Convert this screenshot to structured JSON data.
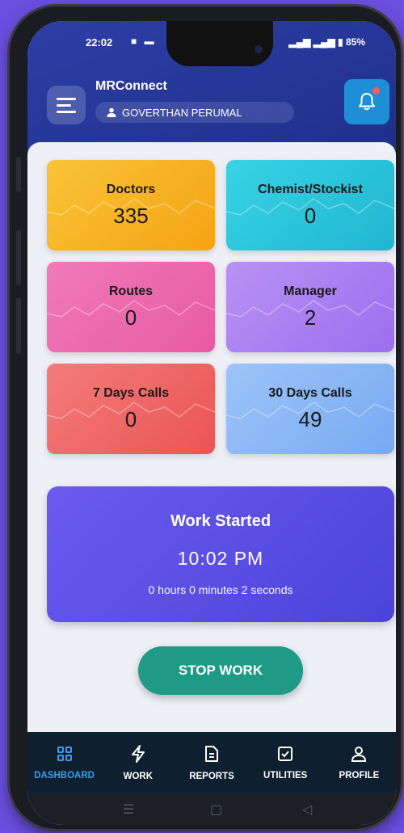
{
  "status_bar": {
    "time": "22:02",
    "left_icons": "■ ▬",
    "right_text": "85%"
  },
  "header": {
    "app_title": "MRConnect",
    "user_name": "GOVERTHAN PERUMAL"
  },
  "stats": [
    {
      "label": "Doctors",
      "value": "335",
      "color_from": "#f8c436",
      "color_to": "#f5a314"
    },
    {
      "label": "Chemist/Stockist",
      "value": "0",
      "color_from": "#38d3e4",
      "color_to": "#20b6d0"
    },
    {
      "label": "Routes",
      "value": "0",
      "color_from": "#f07ab9",
      "color_to": "#e85aa3"
    },
    {
      "label": "Manager",
      "value": "2",
      "color_from": "#b892f3",
      "color_to": "#9c6ef0"
    },
    {
      "label": "7 Days Calls",
      "value": "0",
      "color_from": "#f47c7c",
      "color_to": "#ea5454"
    },
    {
      "label": "30 Days Calls",
      "value": "49",
      "color_from": "#9cc4f8",
      "color_to": "#78aaf2"
    }
  ],
  "work": {
    "title": "Work Started",
    "time": "10:02 PM",
    "duration": "0 hours 0 minutes 2 seconds"
  },
  "stop_button_label": "STOP WORK",
  "nav": {
    "items": [
      {
        "label": "DASHBOARD",
        "icon": "grid-icon",
        "active": true
      },
      {
        "label": "WORK",
        "icon": "bolt-icon",
        "active": false
      },
      {
        "label": "REPORTS",
        "icon": "document-icon",
        "active": false
      },
      {
        "label": "UTILITIES",
        "icon": "checkbox-icon",
        "active": false
      },
      {
        "label": "PROFILE",
        "icon": "person-icon",
        "active": false
      }
    ]
  },
  "colors": {
    "header": "#2c3fa6",
    "accent": "#1e9a85",
    "nav_bg": "#0e1f2f",
    "active_nav": "#3a9ee8"
  }
}
